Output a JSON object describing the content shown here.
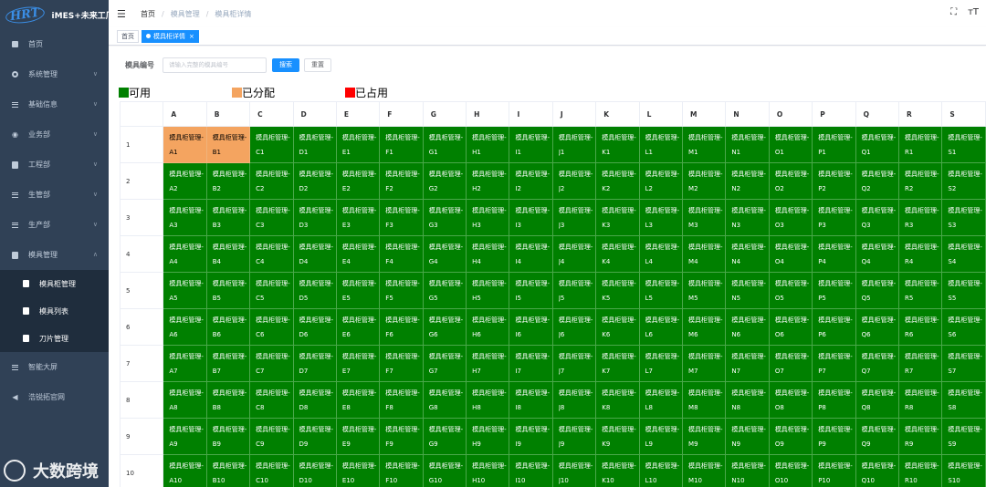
{
  "app": {
    "logo_mark": "HRT",
    "title": "iMES+未来工厂"
  },
  "sidebar": {
    "items": [
      {
        "label": "首页",
        "icon": "dashboard-icon",
        "has_chevron": false
      },
      {
        "label": "系统管理",
        "icon": "gear-icon",
        "has_chevron": true
      },
      {
        "label": "基础信息",
        "icon": "list-icon",
        "has_chevron": true
      },
      {
        "label": "业务部",
        "icon": "globe-icon",
        "has_chevron": true
      },
      {
        "label": "工程部",
        "icon": "document-icon",
        "has_chevron": true
      },
      {
        "label": "生管部",
        "icon": "list-icon",
        "has_chevron": true
      },
      {
        "label": "生产部",
        "icon": "list-icon",
        "has_chevron": true
      },
      {
        "label": "模具管理",
        "icon": "document-icon",
        "has_chevron": true
      }
    ],
    "submenu": [
      {
        "label": "模具柜管理",
        "icon": "document-icon"
      },
      {
        "label": "模具列表",
        "icon": "document-icon"
      },
      {
        "label": "刀片管理",
        "icon": "document-icon"
      }
    ],
    "bottom_items": [
      {
        "label": "智能大屏",
        "icon": "list-icon"
      },
      {
        "label": "浩锐拓官网",
        "icon": "send-icon"
      }
    ]
  },
  "navbar": {
    "breadcrumb": [
      "首页",
      "模具管理",
      "模具柜详情"
    ],
    "fullscreen_icon": "fullscreen-icon",
    "font_size_icon": "font-size-icon"
  },
  "tags": [
    {
      "label": "首页",
      "active": false
    },
    {
      "label": "模具柜详情",
      "active": true
    }
  ],
  "search": {
    "label": "模具编号",
    "placeholder": "请输入完整的模具编号",
    "search_button": "搜索",
    "reset_button": "重置"
  },
  "legend": [
    {
      "label": "可用",
      "color": "#008000"
    },
    {
      "label": "已分配",
      "color": "#f4a460"
    },
    {
      "label": "已占用",
      "color": "#ff0000"
    }
  ],
  "grid": {
    "cell_prefix": "模具柜管理-",
    "columns": [
      "A",
      "B",
      "C",
      "D",
      "E",
      "F",
      "G",
      "H",
      "I",
      "J",
      "K",
      "L",
      "M",
      "N",
      "O",
      "P",
      "Q",
      "R",
      "S"
    ],
    "rows": [
      "1",
      "2",
      "3",
      "4",
      "5",
      "6",
      "7",
      "8",
      "9",
      "10"
    ],
    "status_colors": {
      "available": "#008000",
      "assigned": "#f4a460",
      "occupied": "#ff0000"
    },
    "assigned_cells": [
      "A1",
      "B1"
    ],
    "occupied_cells": []
  },
  "watermark": {
    "text": "大数跨境"
  }
}
